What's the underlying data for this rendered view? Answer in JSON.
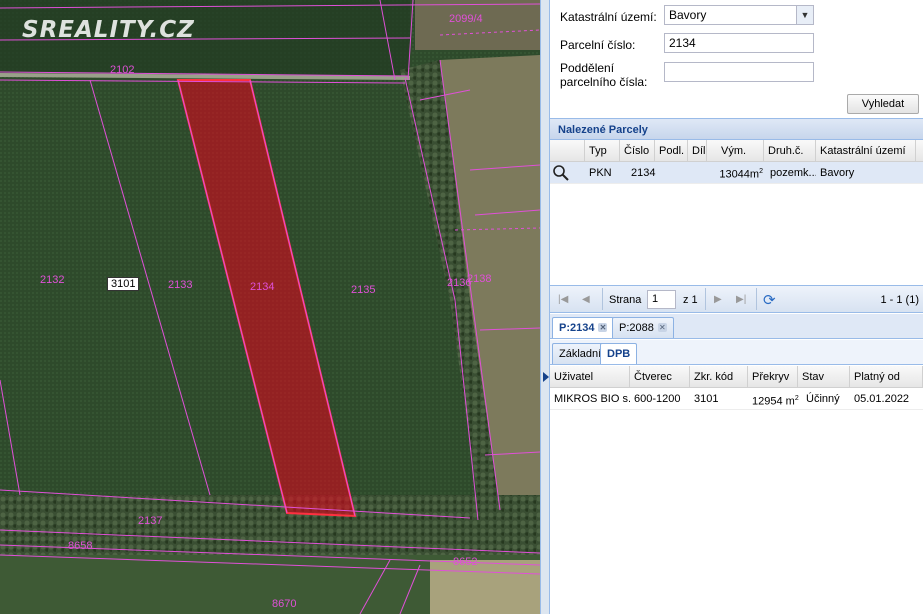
{
  "watermark": "SREALITY.CZ",
  "map": {
    "parcel_labels": [
      "2099/4",
      "2102",
      "2132",
      "2133",
      "2134",
      "2135",
      "2136",
      "2138",
      "2137",
      "8658",
      "8652",
      "8670"
    ],
    "code_box": "3101",
    "highlight_color": "#e8001c",
    "line_color": "#e050d8"
  },
  "form": {
    "cadastral_label": "Katastrální území:",
    "cadastral_value": "Bavory",
    "parcel_label": "Parcelní číslo:",
    "parcel_value": "2134",
    "subdivision_label_1": "Poddělení",
    "subdivision_label_2": "parcelního čísla:",
    "subdivision_value": "",
    "search_button": "Vyhledat"
  },
  "found": {
    "title": "Nalezené Parcely",
    "columns": [
      "Typ",
      "Číslo",
      "Podl.",
      "Díl",
      "Vým.",
      "Druh.č.",
      "Katastrální území"
    ],
    "row": {
      "typ": "PKN",
      "cislo": "2134",
      "podl": "",
      "dil": "",
      "vym": "13044m",
      "vym_sup": "2",
      "druh": "pozemk...",
      "ku": "Bavory"
    }
  },
  "pager": {
    "strana_label": "Strana",
    "page": "1",
    "of_label": "z 1",
    "summary": "1 - 1 (1)"
  },
  "parcel_tabs": [
    "P:2134",
    "P:2088"
  ],
  "sub_tabs": [
    "Základní",
    "DPB"
  ],
  "dpb": {
    "columns": [
      "Uživatel",
      "Čtverec",
      "Zkr. kód",
      "Překryv",
      "Stav",
      "Platný od"
    ],
    "row": {
      "uzivatel": "MIKROS BIO s...",
      "ctverec": "600-1200",
      "kod": "3101",
      "prekryv": "12954 m",
      "prekryv_sup": "2",
      "stav": "Účinný",
      "platny": "05.01.2022"
    }
  },
  "colors": {
    "header_blue": "#15428b",
    "selected_row": "#dfe8f6",
    "field_green": "#2f4a2b"
  }
}
